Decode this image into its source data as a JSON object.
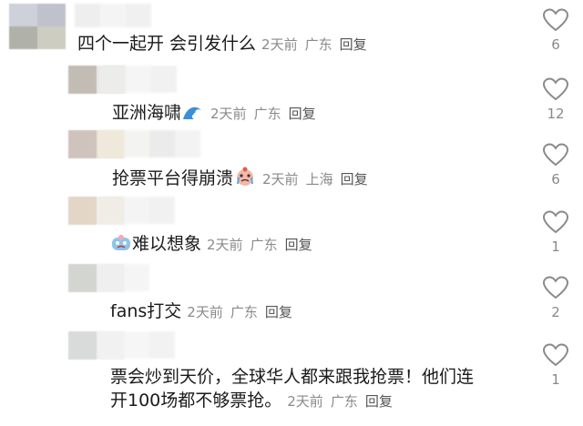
{
  "comments": [
    {
      "text": "四个一起开 会引发什么",
      "time": "2天前",
      "location": "广东",
      "reply": "回复",
      "likes": "6"
    },
    {
      "text": "亚洲海啸",
      "emoji": "wave-emoji",
      "time": "2天前",
      "location": "广东",
      "reply": "回复",
      "likes": "12"
    },
    {
      "text": "抢票平台得崩溃",
      "emoji": "crying-face-emoji",
      "time": "2天前",
      "location": "上海",
      "reply": "回复",
      "likes": "6"
    },
    {
      "text": "难以想象",
      "emoji": "crying-sticker-emoji",
      "time": "2天前",
      "location": "广东",
      "reply": "回复",
      "likes": "1"
    },
    {
      "text": "fans打交",
      "time": "2天前",
      "location": "广东",
      "reply": "回复",
      "likes": "2"
    },
    {
      "text_line1": "票会炒到天价，全球华人都来跟我抢票！他们连",
      "text_line2": "开100场都不够票抢。",
      "time": "2天前",
      "location": "广东",
      "reply": "回复",
      "likes": "1"
    }
  ],
  "colors": {
    "text": "#1a1a1a",
    "meta": "#8a8a8a",
    "heart_outline": "#8a8a8a"
  },
  "icons": {
    "like": "heart-outline-icon"
  }
}
